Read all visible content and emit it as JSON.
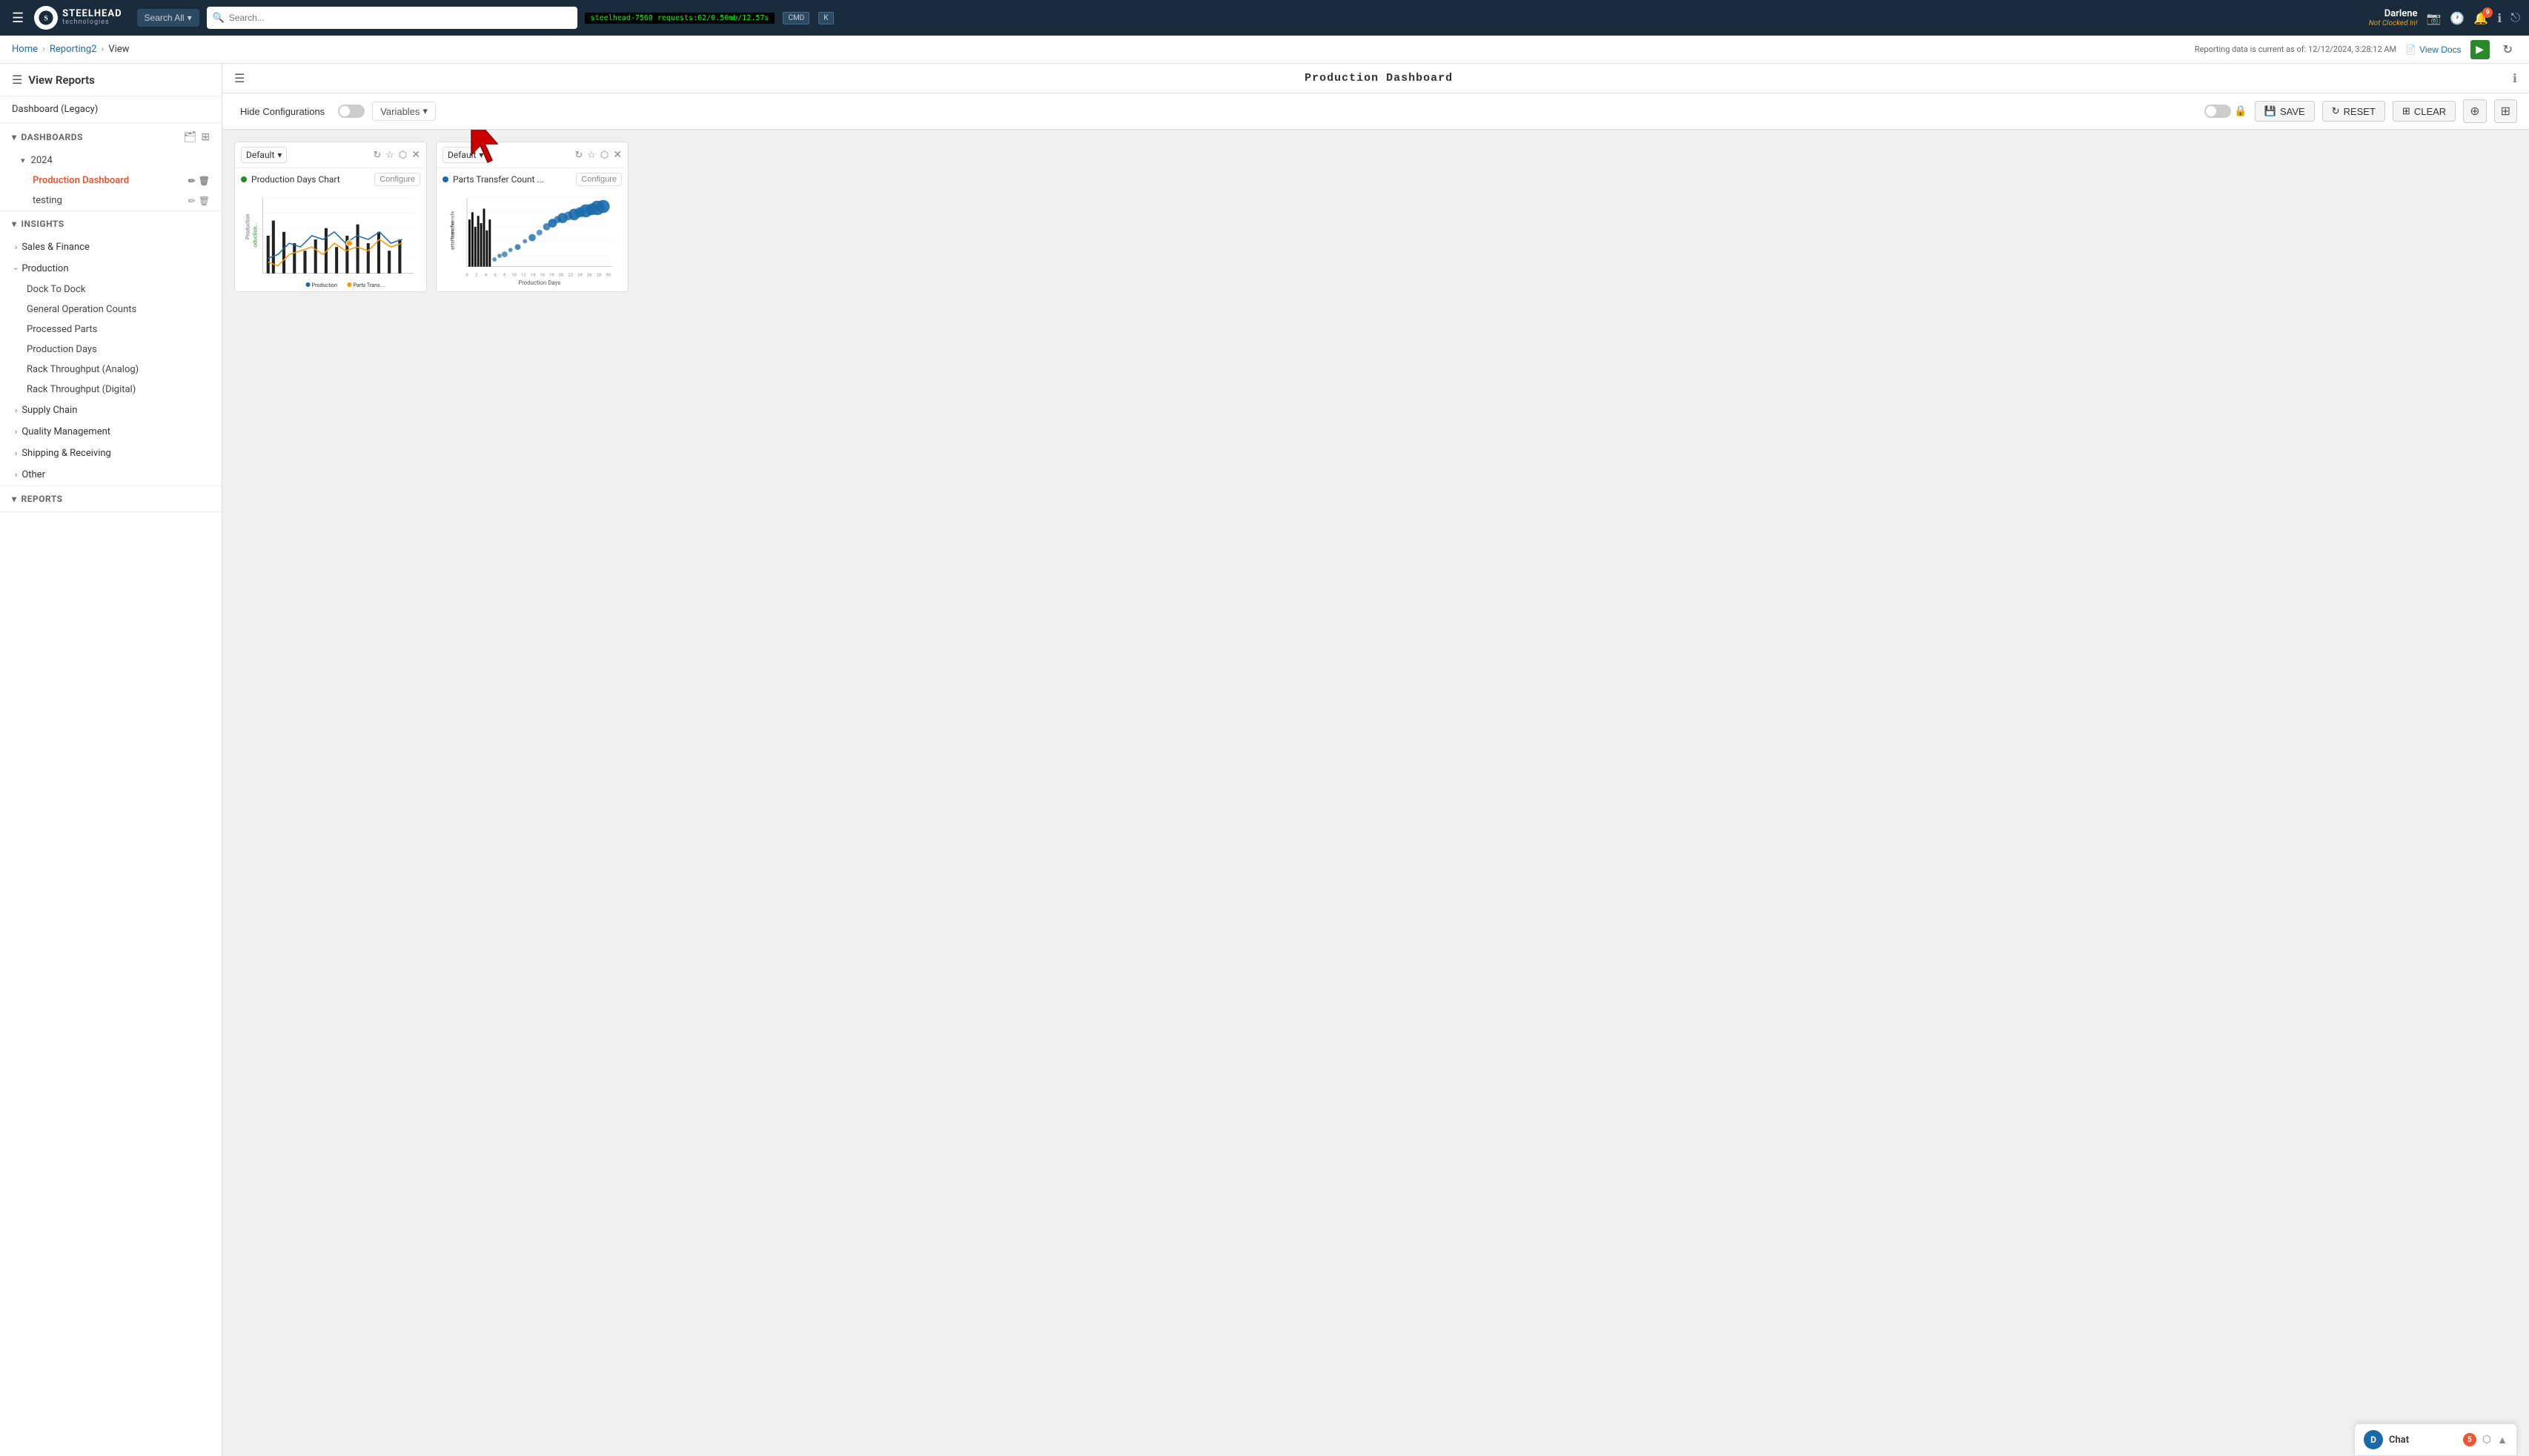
{
  "topnav": {
    "hamburger_icon": "☰",
    "brand": "STEELHEAD",
    "sub": "technologies",
    "search_all_label": "Search All",
    "search_placeholder": "Search...",
    "system_info": "steelhead-7560  requests:62/0.50mb/12.57s",
    "cmd_label": "CMD",
    "k_label": "K",
    "user_name": "Darlene",
    "user_status": "Not Clocked In!",
    "notification_count": "9"
  },
  "breadcrumb": {
    "home": "Home",
    "reporting": "Reporting2",
    "current": "View",
    "view_docs": "View Docs",
    "reporting_data": "Reporting data is current as of:  12/12/2024, 3:28:12 AM"
  },
  "sidebar": {
    "title": "View Reports",
    "legacy_label": "Dashboard (Legacy)",
    "dashboards_label": "DASHBOARDS",
    "year_2024": "2024",
    "active_dashboard": "Production Dashboard",
    "dashboard_testing": "testing",
    "insights_label": "INSIGHTS",
    "insights_groups": [
      {
        "label": "Sales & Finance",
        "expanded": false
      },
      {
        "label": "Production",
        "expanded": true,
        "items": [
          "Dock To Dock",
          "General Operation Counts",
          "Processed Parts",
          "Production Days",
          "Rack Throughput (Analog)",
          "Rack Throughput (Digital)"
        ]
      },
      {
        "label": "Supply Chain",
        "expanded": false
      },
      {
        "label": "Quality Management",
        "expanded": false
      },
      {
        "label": "Shipping & Receiving",
        "expanded": false
      },
      {
        "label": "Other",
        "expanded": false
      }
    ],
    "reports_label": "REPORTS"
  },
  "dashboard": {
    "title": "Production Dashboard",
    "hide_config_label": "Hide Configurations",
    "variables_label": "Variables",
    "save_label": "SAVE",
    "reset_label": "RESET",
    "clear_label": "CLEAR",
    "add_icon": "⊕"
  },
  "charts": [
    {
      "selector_label": "Default",
      "title": "Production Days Chart",
      "dot_color": "green",
      "configure_label": "Configure",
      "x_title": "",
      "chart_type": "line"
    },
    {
      "selector_label": "Default",
      "title": "Parts Transfer Count ...",
      "dot_color": "blue",
      "configure_label": "Configure",
      "x_title": "Production Days",
      "x_labels": [
        "0",
        "2",
        "4",
        "6",
        "8",
        "10",
        "12",
        "14",
        "16",
        "18",
        "20",
        "22",
        "24",
        "26",
        "28",
        "30"
      ],
      "chart_type": "scatter"
    }
  ],
  "chat": {
    "avatar_letter": "D",
    "label": "Chat",
    "badge_count": "5"
  }
}
